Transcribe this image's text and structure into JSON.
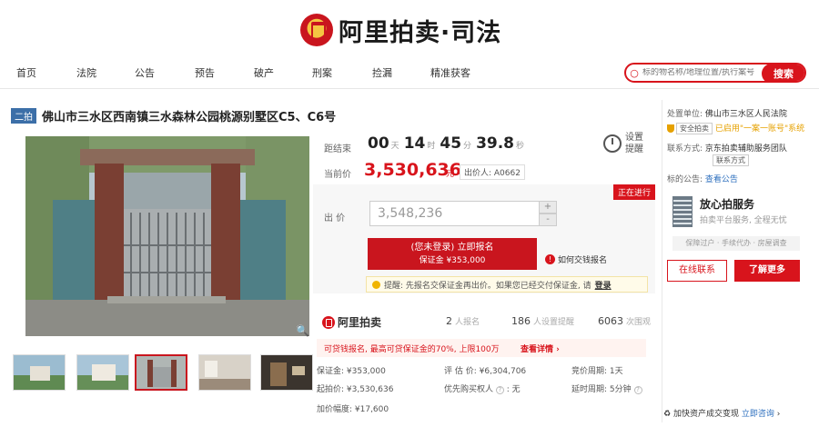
{
  "brand": {
    "name": "阿里拍卖·司法"
  },
  "nav": {
    "items": [
      "首页",
      "法院",
      "公告",
      "预告",
      "破产",
      "刑案",
      "捡漏",
      "精准获客"
    ]
  },
  "search": {
    "placeholder": "标的物名称/地理位置/执行案号",
    "button_label": "搜索"
  },
  "lot": {
    "badge": "二拍",
    "title": "佛山市三水区西南镇三水森林公园桃源别墅区C5、C6号"
  },
  "countdown": {
    "label": "距结束",
    "days": "00",
    "days_unit": "天",
    "hours": "14",
    "hours_unit": "时",
    "minutes": "45",
    "minutes_unit": "分",
    "seconds": "39.8",
    "seconds_unit": "秒"
  },
  "reminder_label": "设置提醒",
  "current_price": {
    "label": "当前价",
    "value": "3,530,636",
    "unit": "元",
    "bidder": "出价人: A0662"
  },
  "status": "正在进行",
  "bid": {
    "label": "出 价",
    "value": "3,548,236",
    "plus": "+",
    "minus": "-"
  },
  "signup": {
    "line1": "(您未登录) 立即报名",
    "line2": "保证金 ¥353,000"
  },
  "howto_label": "如何交钱报名",
  "notice": {
    "text": "提醒: 先报名交保证金再出价。如果您已经交付保证金, 请",
    "link": "登录"
  },
  "brand_small": "阿里拍卖",
  "stats": [
    {
      "value": "2",
      "label": "人报名"
    },
    {
      "value": "186",
      "label": "人设置提醒"
    },
    {
      "value": "6063",
      "label": "次围观"
    }
  ],
  "promo": {
    "text": "可贷钱报名, 最高可贷保证金的70%, 上限100万",
    "link": "查看详情 ›"
  },
  "info": {
    "deposit": "保证金: ¥353,000",
    "appraisal": "评 估 价: ¥6,304,706",
    "cycle": "竞价周期: 1天",
    "start_price": "起拍价: ¥3,530,636",
    "priority": "优先购买权人",
    "priority_value": ": 无",
    "delay": "延时周期: 5分钟",
    "increment": "加价幅度: ¥17,600"
  },
  "court": {
    "label": "处置单位:",
    "name": "佛山市三水区人民法院",
    "verify_badge": "安全拍卖",
    "verify_text": "已启用\"一案一账号\"系统",
    "contact_label": "联系方式:",
    "contact_value": "京东拍卖辅助服务团队",
    "contact_tag": "联系方式",
    "announce_label": "标的公告:",
    "announce_link": "查看公告"
  },
  "service": {
    "title": "放心拍服务",
    "subtitle": "拍卖平台服务, 全程无忧",
    "tags": "保障过户 · 手续代办 · 房屋调查",
    "contact_btn": "在线联系",
    "more_btn": "了解更多"
  },
  "consult": {
    "text": "加快资产成交变现",
    "link": "立即咨询",
    "arrow": "›"
  }
}
